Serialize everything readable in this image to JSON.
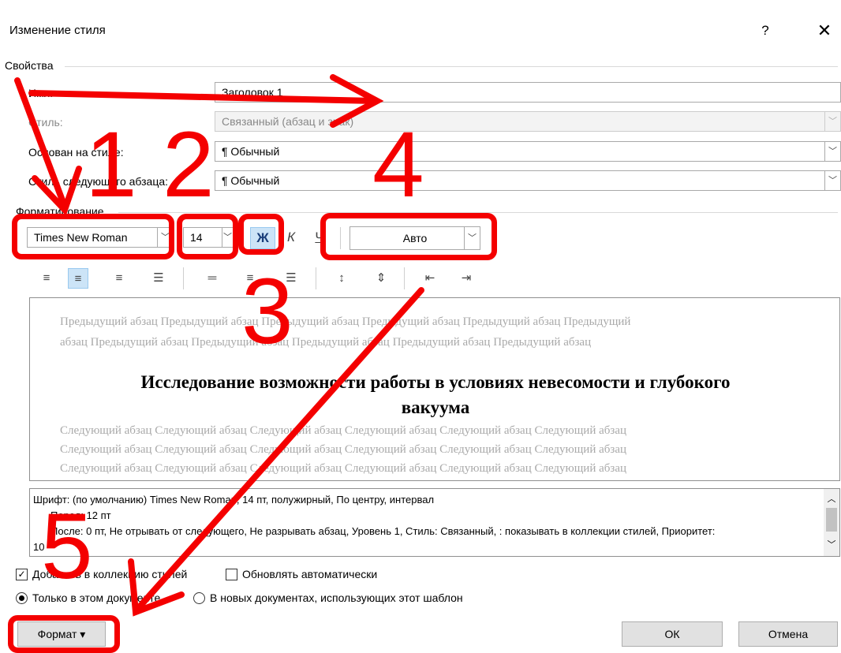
{
  "dialog": {
    "title": "Изменение стиля",
    "help": "?",
    "close": "✕"
  },
  "properties": {
    "section": "Свойства",
    "name_label": "Имя:",
    "name_value": "Заголовок 1",
    "type_label": "Стиль:",
    "type_value": "Связанный (абзац и знак)",
    "based_label": "Основан на стиле:",
    "based_value": "¶ Обычный",
    "next_label": "Стиль следующего абзаца:",
    "next_value": "¶ Обычный"
  },
  "formatting": {
    "section": "Форматирование",
    "font": "Times New Roman",
    "size": "14",
    "bold": "Ж",
    "italic": "К",
    "underline": "Ч",
    "color": "Авто",
    "align_icons": [
      "align-left-icon",
      "align-center-icon",
      "align-right-icon",
      "align-justify-icon"
    ],
    "spacing_icons": [
      "single-spacing-icon",
      "onehalf-spacing-icon",
      "double-spacing-icon",
      "line-spacing-increase-icon",
      "line-spacing-decrease-icon",
      "indent-decrease-icon",
      "indent-increase-icon"
    ]
  },
  "preview": {
    "prev_lines": [
      "Предыдущий абзац Предыдущий абзац Предыдущий абзац Предыдущий абзац Предыдущий абзац Предыдущий",
      "абзац Предыдущий абзац Предыдущий абзац Предыдущий абзац Предыдущий абзац Предыдущий абзац"
    ],
    "heading_line1": "Исследование возможности работы в условиях невесомости и глубокого",
    "heading_line2": "вакуума",
    "next_lines": [
      "Следующий абзац Следующий абзац Следующий абзац Следующий абзац Следующий абзац Следующий абзац",
      "Следующий абзац Следующий абзац Следующий абзац Следующий абзац Следующий абзац Следующий абзац",
      "Следующий абзац Следующий абзац Следующий абзац Следующий абзац Следующий абзац Следующий абзац"
    ]
  },
  "description": {
    "line1": "Шрифт: (по умолчанию) Times New Roman, 14 пт, полужирный, По центру, интервал",
    "line2": "Перед: 12 пт",
    "line3": "После: 0 пт, Не отрывать от следующего, Не разрывать абзац, Уровень 1, Стиль: Связанный, : показывать в коллекции стилей, Приоритет:",
    "line4": "10"
  },
  "options": {
    "add_gallery": "Добавить в коллекцию стилей",
    "add_gallery_checked": true,
    "auto_update": "Обновлять автоматически",
    "auto_update_checked": false,
    "only_doc": "Только в этом документе",
    "new_docs": "В новых документах, использующих этот шаблон",
    "selected_scope": "only_doc"
  },
  "buttons": {
    "format": "Формат ▾",
    "ok": "ОК",
    "cancel": "Отмена"
  },
  "annotations": {
    "color": "#f40000",
    "numbers": [
      "1",
      "2",
      "3",
      "4",
      "5"
    ]
  }
}
